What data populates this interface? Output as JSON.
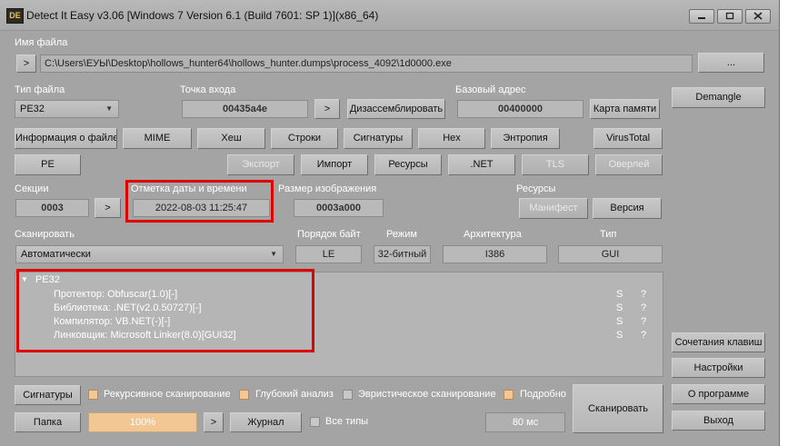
{
  "window": {
    "title": "Detect It Easy v3.06 [Windows 7 Version 6.1 (Build 7601: SP 1)](x86_64)",
    "icon_text": "DE"
  },
  "file": {
    "label": "Имя файла",
    "nav_button": ">",
    "path": "C:\\Users\\ЕУЫ\\Desktop\\hollows_hunter64\\hollows_hunter.dumps\\process_4092\\1d0000.exe",
    "browse_button": "..."
  },
  "info": {
    "file_type_label": "Тип файла",
    "file_type_value": "PE32",
    "entry_label": "Точка входа",
    "entry_value": "00435a4e",
    "entry_nav": ">",
    "disasm_button": "Дизассемблировать",
    "base_label": "Базовый адрес",
    "base_value": "00400000",
    "memmap_button": "Карта памяти"
  },
  "toolbar1": [
    "Информация о файле",
    "MIME",
    "Хеш",
    "Строки",
    "Сигнатуры",
    "Hex",
    "Энтропия",
    "VirusTotal"
  ],
  "toolbar2": {
    "pe": "PE",
    "export": "Экспорт",
    "import": "Импорт",
    "resources": "Ресурсы",
    "net": ".NET",
    "tls": "TLS",
    "overlay": "Оверлей"
  },
  "sections": {
    "label": "Секции",
    "value": "0003",
    "nav": ">",
    "timestamp_label": "Отметка даты и времени",
    "timestamp_value": "2022-08-03 11:25:47",
    "image_size_label": "Размер изображения",
    "image_size_value": "0003a000",
    "resources_label": "Ресурсы",
    "manifest_button": "Манифест",
    "version_button": "Версия"
  },
  "scan": {
    "label": "Сканировать",
    "mode_value": "Автоматически",
    "byte_order_label": "Порядок байт",
    "byte_order_value": "LE",
    "mode_label": "Режим",
    "mode_bits": "32-битный",
    "arch_label": "Архитектура",
    "arch_value": "I386",
    "type_label": "Тип",
    "type_value": "GUI"
  },
  "results": {
    "root": "PE32",
    "items": [
      {
        "text": "Протектор: Obfuscar(1.0)[-]",
        "s": "S",
        "q": "?"
      },
      {
        "text": "Библиотека: .NET(v2.0.50727)[-]",
        "s": "S",
        "q": "?"
      },
      {
        "text": "Компилятор: VB.NET(-)[-]",
        "s": "S",
        "q": "?"
      },
      {
        "text": "Линковщик: Microsoft Linker(8.0)[GUI32]",
        "s": "S",
        "q": "?"
      }
    ]
  },
  "side": {
    "demangle": "Demangle",
    "shortcuts": "Сочетания клавиш",
    "settings": "Настройки",
    "about": "О программе",
    "exit": "Выход"
  },
  "bottom": {
    "signatures_button": "Сигнатуры",
    "recursive": {
      "label": "Рекурсивное сканирование",
      "checked": true
    },
    "deep": {
      "label": "Глубокий анализ",
      "checked": true
    },
    "heuristic": {
      "label": "Эвристическое сканирование",
      "checked": false
    },
    "verbose": {
      "label": "Подробно",
      "checked": true
    },
    "folder_button": "Папка",
    "progress_value": "100%",
    "nav": ">",
    "log_button": "Журнал",
    "all_types": {
      "label": "Все типы",
      "checked": false
    },
    "time": "80 мс",
    "scan_button": "Сканировать"
  }
}
